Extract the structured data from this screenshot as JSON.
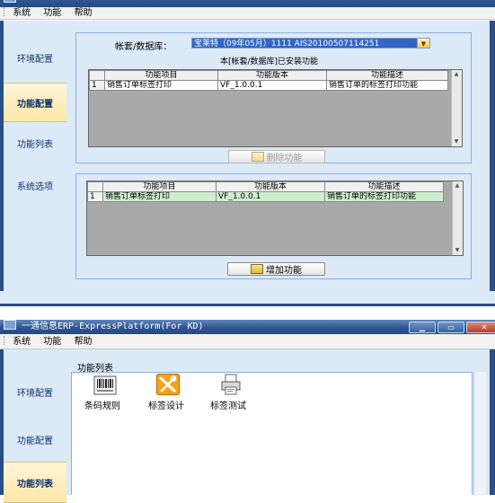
{
  "window1": {
    "menu": [
      "系统",
      "功能",
      "帮助"
    ],
    "nav": [
      "环境配置",
      "功能配置",
      "功能列表",
      "系统选项"
    ],
    "account_label": "帐套/数据库：",
    "account_value": "宝莱特（09年05月）1111    AIS20100507114251",
    "installed_caption": "本[帐套/数据库]已安装功能",
    "columns": [
      "功能项目",
      "功能版本",
      "功能描述"
    ],
    "installed_rows": [
      {
        "num": "1",
        "item": "销售订单标签打印",
        "version": "VF_1.0.0.1",
        "desc": "销售订单的标签打印功能"
      }
    ],
    "delete_button": "删除功能",
    "available_rows": [
      {
        "num": "1",
        "item": "销售订单标签打印",
        "version": "VF_1.0.0.1",
        "desc": "销售订单的标签打印功能"
      }
    ],
    "add_button": "增加功能"
  },
  "window2": {
    "title": "一通信息ERP-ExpressPlatform(For KD)",
    "menu": [
      "系统",
      "功能",
      "帮助"
    ],
    "nav": [
      "环境配置",
      "功能配置",
      "功能列表"
    ],
    "panel_title": "功能列表",
    "functions": [
      {
        "label": "条码规则",
        "icon": "barcode-icon"
      },
      {
        "label": "标签设计",
        "icon": "tools-icon"
      },
      {
        "label": "标签测试",
        "icon": "printer-icon"
      }
    ]
  }
}
